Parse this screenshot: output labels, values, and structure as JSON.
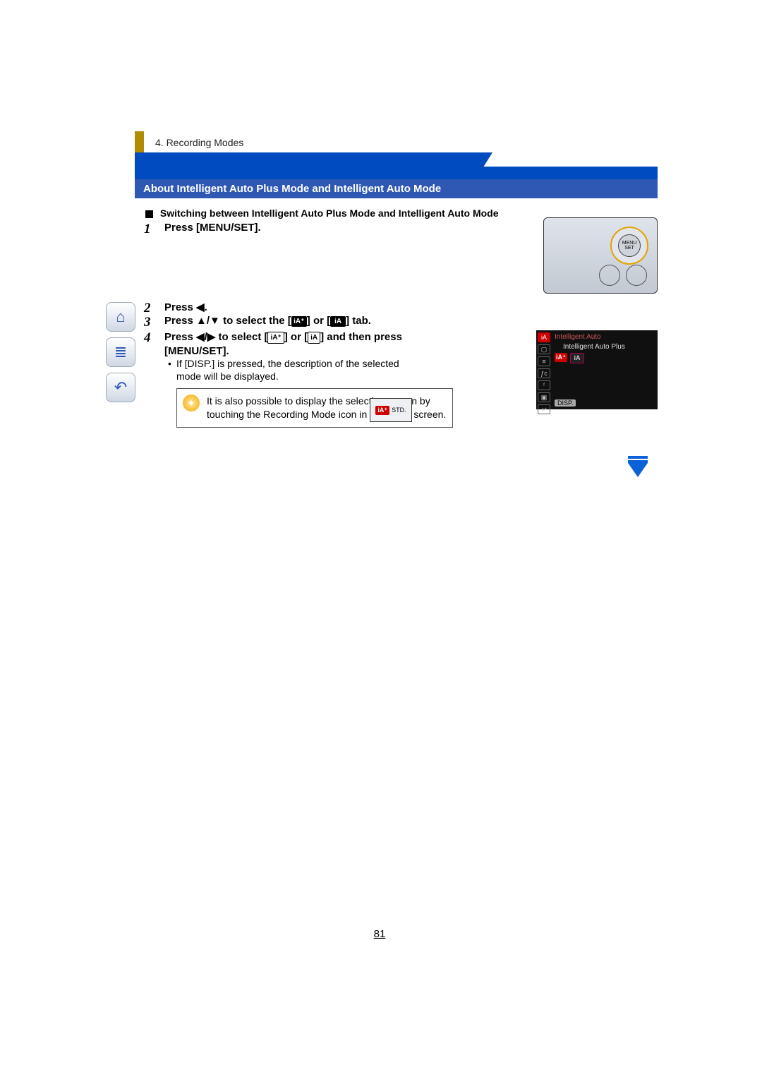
{
  "breadcrumb": "4. Recording Modes",
  "section_title": "About Intelligent Auto Plus Mode and Intelligent Auto Mode",
  "sub_heading": "Switching between Intelligent Auto Plus Mode and Intelligent Auto Mode",
  "nav": {
    "home_icon": "home-icon",
    "toc_icon": "list-icon",
    "back_icon": "return-icon"
  },
  "steps": {
    "s1": {
      "num": "1",
      "text": "Press [MENU/SET]."
    },
    "s2": {
      "num": "2",
      "text_prefix": "Press ",
      "arrow": "◀",
      "text_suffix": "."
    },
    "s3": {
      "num": "3",
      "prefix": "Press ",
      "arrows": "▲/▼",
      "mid": " to select the [",
      "tab_a": "iA⁺",
      "between": "] or [",
      "tab_b": "iA",
      "suffix": "] tab."
    },
    "s4": {
      "num": "4",
      "prefix": "Press ",
      "arrows": "◀/▶",
      "mid": " to select [",
      "opt_a": "iA⁺",
      "between": "] or [",
      "opt_b": "iA",
      "after": "] and then press ",
      "tail": "[MENU/SET]."
    }
  },
  "note": "If [DISP.] is pressed, the description of the selected mode will be displayed.",
  "tip": "It is also possible to display the selection screen by touching the Recording Mode icon in recording screen.",
  "camera": {
    "menu_label": "MENU\nSET"
  },
  "touch_ill": {
    "badge": "iA⁺",
    "std": "STD."
  },
  "menu_screen": {
    "header": "Intelligent Auto",
    "option": "Intelligent Auto Plus",
    "sel_on": "iA⁺",
    "sel_off": "iA",
    "disp": "DISP.",
    "left_icons": [
      "iA",
      "▢",
      "≡",
      "ƒc",
      "ᶠ",
      "▣",
      "↩"
    ]
  },
  "page_number": "81"
}
